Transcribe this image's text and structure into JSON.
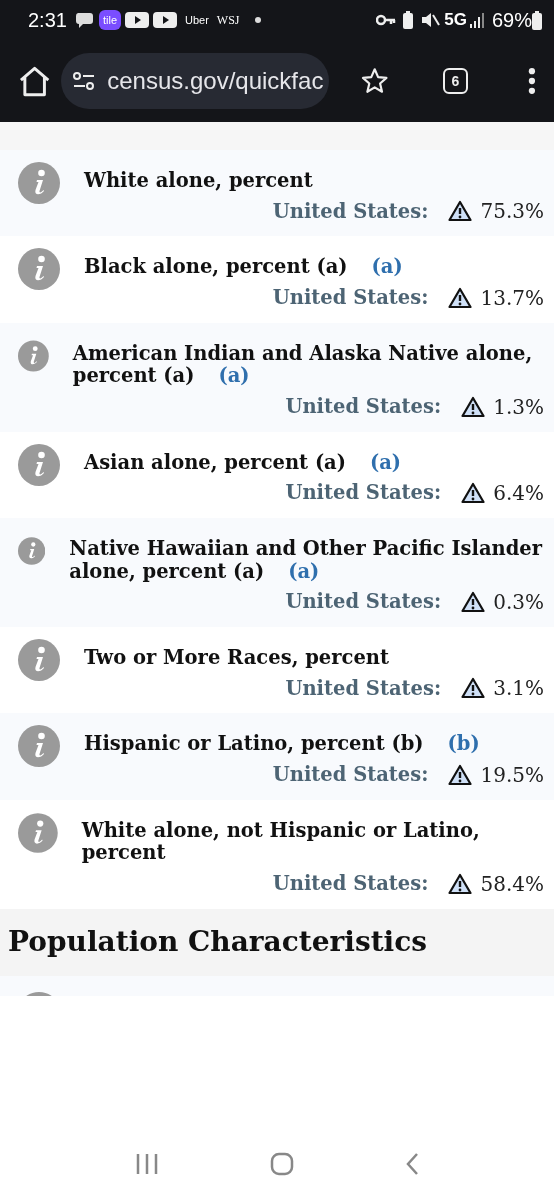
{
  "status_bar": {
    "time": "2:31",
    "app_badge": "tile",
    "apps": [
      "Uber",
      "WSJ"
    ],
    "network": "5G",
    "battery": "69%"
  },
  "browser": {
    "url": "census.gov/quickfac",
    "tab_count": "6"
  },
  "rows": [
    {
      "title": "White alone, percent",
      "label": "United States:",
      "value": "75.3%"
    },
    {
      "title": "Black alone, percent (a)",
      "footnote": "(a)",
      "label": "United States:",
      "value": "13.7%"
    },
    {
      "title": "American Indian and Alaska Native alone, percent (a)",
      "footnote": "(a)",
      "label": "United States:",
      "value": "1.3%"
    },
    {
      "title": "Asian alone, percent (a)",
      "footnote": "(a)",
      "label": "United States:",
      "value": "6.4%"
    },
    {
      "title": "Native Hawaiian and Other Pacific Islander alone, percent (a)",
      "footnote": "(a)",
      "label": "United States:",
      "value": "0.3%"
    },
    {
      "title": "Two or More Races, percent",
      "label": "United States:",
      "value": "3.1%"
    },
    {
      "title": "Hispanic or Latino, percent (b)",
      "footnote": "(b)",
      "label": "United States:",
      "value": "19.5%"
    },
    {
      "title": "White alone, not Hispanic or Latino, percent",
      "label": "United States:",
      "value": "58.4%"
    }
  ],
  "section": {
    "heading": "Population Characteristics"
  }
}
